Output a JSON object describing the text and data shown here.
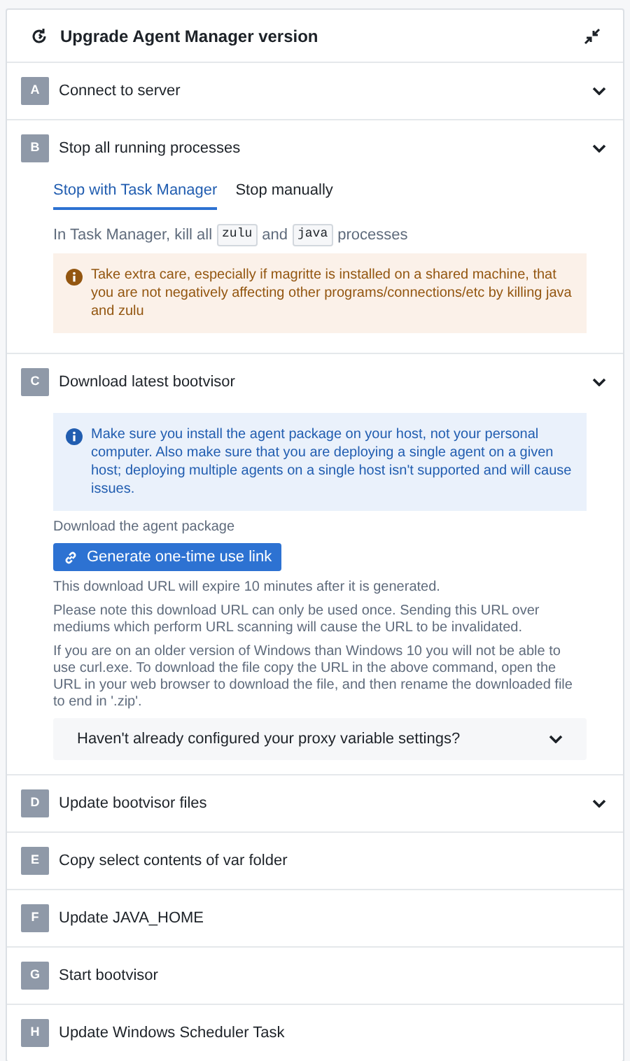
{
  "header": {
    "title": "Upgrade Agent Manager version"
  },
  "steps": [
    {
      "letter": "A",
      "title": "Connect to server",
      "chevron": true,
      "expanded": false
    },
    {
      "letter": "B",
      "title": "Stop all running processes",
      "chevron": true,
      "expanded": true,
      "content": [
        {
          "kind": "tabs",
          "tabs": [
            {
              "label": "Stop with Task Manager",
              "selected": true
            },
            {
              "label": "Stop manually",
              "selected": false
            }
          ]
        },
        {
          "kind": "inline",
          "segments": [
            {
              "kind": "text",
              "text": "In Task Manager, kill all"
            },
            {
              "kind": "code",
              "text": "zulu"
            },
            {
              "kind": "text",
              "text": "and"
            },
            {
              "kind": "code",
              "text": "java"
            },
            {
              "kind": "text",
              "text": "processes"
            }
          ]
        },
        {
          "kind": "warning",
          "text": "Take extra care, especially if magritte is installed on a shared machine, that you are not negatively affecting other programs/connections/etc by killing java and zulu"
        }
      ]
    },
    {
      "letter": "C",
      "title": "Download latest bootvisor",
      "chevron": true,
      "expanded": true,
      "content": [
        {
          "kind": "info",
          "text": "Make sure you install the agent package on your host, not your personal computer. Also make sure that you are deploying a single agent on a given host; deploying multiple agents on a single host isn't supported and will cause issues."
        },
        {
          "kind": "paragraph",
          "text": "Download the agent package"
        },
        {
          "kind": "button",
          "text": "Generate one-time use link"
        },
        {
          "kind": "paragraph",
          "text": "This download URL will expire 10 minutes after it is generated."
        },
        {
          "kind": "paragraph",
          "text": "Please note this download URL can only be used once. Sending this URL over mediums which perform URL scanning will cause the URL to be invalidated."
        },
        {
          "kind": "paragraph",
          "text": "If you are on an older version of Windows than Windows 10 you will not be able to use curl.exe. To download the file copy the URL in the above command, open the URL in your web browser to download the file, and then rename the downloaded file to end in '.zip'."
        },
        {
          "kind": "collapsible",
          "text": "Haven't already configured your proxy variable settings?",
          "expanded": false
        }
      ]
    },
    {
      "letter": "D",
      "title": "Update bootvisor files",
      "chevron": true,
      "expanded": false
    },
    {
      "letter": "E",
      "title": "Copy select contents of var folder",
      "chevron": false
    },
    {
      "letter": "F",
      "title": "Update JAVA_HOME",
      "chevron": false
    },
    {
      "letter": "G",
      "title": "Start bootvisor",
      "chevron": false
    },
    {
      "letter": "H",
      "title": "Update Windows Scheduler Task",
      "chevron": false
    }
  ]
}
